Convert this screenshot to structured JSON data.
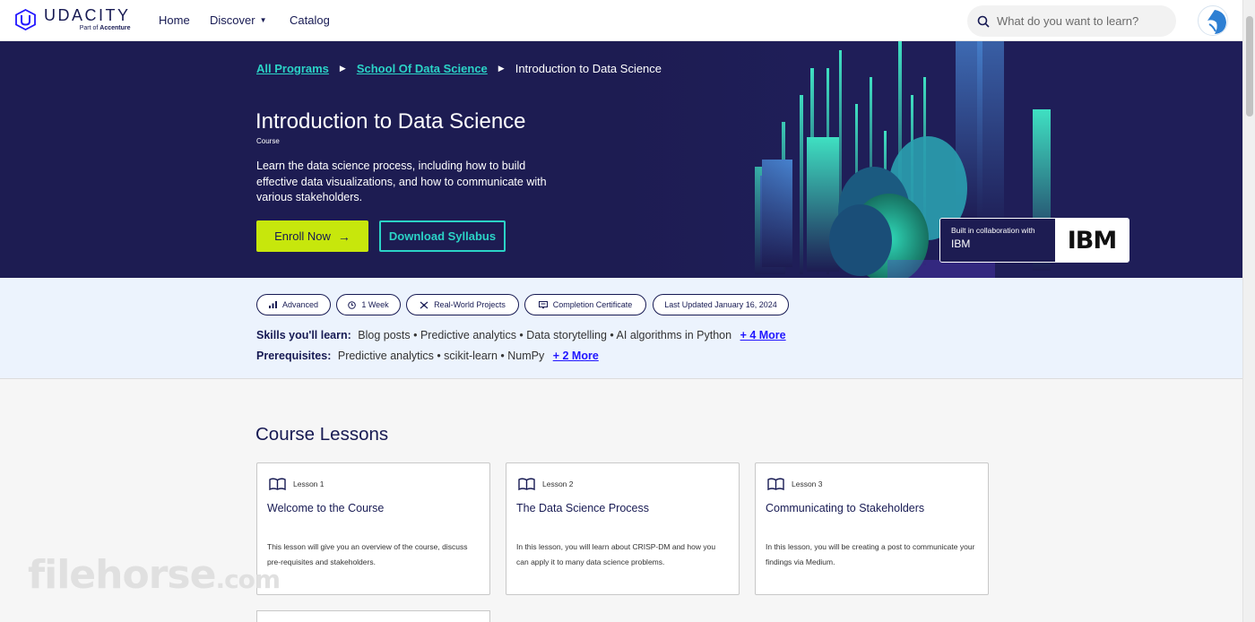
{
  "nav": {
    "logo": {
      "word": "UDACITY",
      "sub_prefix": "Part of",
      "sub_brand": "Accenture"
    },
    "links": {
      "home": "Home",
      "discover": "Discover",
      "catalog": "Catalog"
    },
    "search_placeholder": "What do you want to learn?"
  },
  "hero": {
    "breadcrumb": {
      "item1": "All Programs",
      "item2": "School Of Data Science",
      "current": "Introduction to Data Science"
    },
    "title": "Introduction to Data Science",
    "type": "Course",
    "description": "Learn the data science process, including how to build effective data visualizations, and how to communicate with various stakeholders.",
    "enroll_label": "Enroll Now",
    "syllabus_label": "Download Syllabus",
    "collab_label": "Built in collaboration with",
    "collab_partner": "IBM",
    "partner_logo_text": "IBM"
  },
  "info": {
    "chips": {
      "level": "Advanced",
      "duration": "1 Week",
      "projects": "Real-World Projects",
      "certificate": "Completion Certificate",
      "updated": "Last Updated January 16, 2024"
    },
    "skills_label": "Skills you'll learn:",
    "skills_text": "Blog posts • Predictive analytics • Data storytelling • AI algorithms in Python",
    "skills_more": "+ 4 More",
    "prereq_label": "Prerequisites:",
    "prereq_text": "Predictive analytics • scikit-learn • NumPy",
    "prereq_more": "+ 2 More"
  },
  "lessons": {
    "section_title": "Course Lessons",
    "cards": [
      {
        "num": "Lesson 1",
        "title": "Welcome to the Course",
        "desc": "This lesson will give you an overview of the course, discuss pre-requisites and stakeholders."
      },
      {
        "num": "Lesson 2",
        "title": "The Data Science Process",
        "desc": "In this lesson, you will learn about CRISP-DM and how you can apply it to many data science problems."
      },
      {
        "num": "Lesson 3",
        "title": "Communicating to Stakeholders",
        "desc": "In this lesson, you will be creating a post to communicate your findings via Medium."
      }
    ]
  },
  "watermark": {
    "main": "filehorse",
    "suffix": ".com"
  },
  "colors": {
    "navy": "#171a53",
    "hero_bg": "#1d1c52",
    "teal": "#2bd3c6",
    "lime": "#c7e70c",
    "link_blue": "#2015ff",
    "info_bg": "#ecf3fd"
  },
  "icons": [
    "udacity-logo-icon",
    "search-icon",
    "user-avatar-icon",
    "level-bars-icon",
    "clock-icon",
    "projects-icon",
    "certificate-icon",
    "book-icon",
    "arrow-right-icon"
  ]
}
